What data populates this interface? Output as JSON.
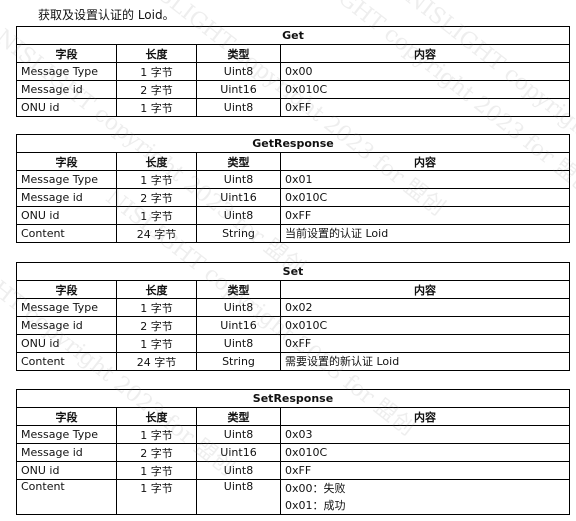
{
  "intro": "获取及设置认证的 Loid。",
  "columns": [
    "字段",
    "长度",
    "类型",
    "内容"
  ],
  "tables": [
    {
      "title": "Get",
      "rows": [
        {
          "name": "Message Type",
          "len": "1 字节",
          "type": "Uint8",
          "content": [
            "0x00"
          ]
        },
        {
          "name": "Message id",
          "len": "2 字节",
          "type": "Uint16",
          "content": [
            "0x010C"
          ]
        },
        {
          "name": "ONU id",
          "len": "1 字节",
          "type": "Uint8",
          "content": [
            "0xFF"
          ]
        }
      ]
    },
    {
      "title": "GetResponse",
      "rows": [
        {
          "name": "Message Type",
          "len": "1 字节",
          "type": "Uint8",
          "content": [
            "0x01"
          ]
        },
        {
          "name": "Message id",
          "len": "2 字节",
          "type": "Uint16",
          "content": [
            "0x010C"
          ]
        },
        {
          "name": "ONU id",
          "len": "1 字节",
          "type": "Uint8",
          "content": [
            "0xFF"
          ]
        },
        {
          "name": "Content",
          "len": "24 字节",
          "type": "String",
          "content": [
            "当前设置的认证 Loid"
          ]
        }
      ]
    },
    {
      "title": "Set",
      "rows": [
        {
          "name": "Message Type",
          "len": "1 字节",
          "type": "Uint8",
          "content": [
            "0x02"
          ]
        },
        {
          "name": "Message id",
          "len": "2 字节",
          "type": "Uint16",
          "content": [
            "0x010C"
          ]
        },
        {
          "name": "ONU id",
          "len": "1 字节",
          "type": "Uint8",
          "content": [
            "0xFF"
          ]
        },
        {
          "name": "Content",
          "len": "24 字节",
          "type": "String",
          "content": [
            "需要设置的新认证 Loid"
          ]
        }
      ]
    },
    {
      "title": "SetResponse",
      "rows": [
        {
          "name": "Message Type",
          "len": "1 字节",
          "type": "Uint8",
          "content": [
            "0x03"
          ]
        },
        {
          "name": "Message id",
          "len": "2 字节",
          "type": "Uint16",
          "content": [
            "0x010C"
          ]
        },
        {
          "name": "ONU id",
          "len": "1 字节",
          "type": "Uint8",
          "content": [
            "0xFF"
          ]
        },
        {
          "name": "Content",
          "len": "1 字节",
          "type": "Uint8",
          "content": [
            "0x00：失败",
            "0x01：成功"
          ]
        }
      ]
    }
  ]
}
